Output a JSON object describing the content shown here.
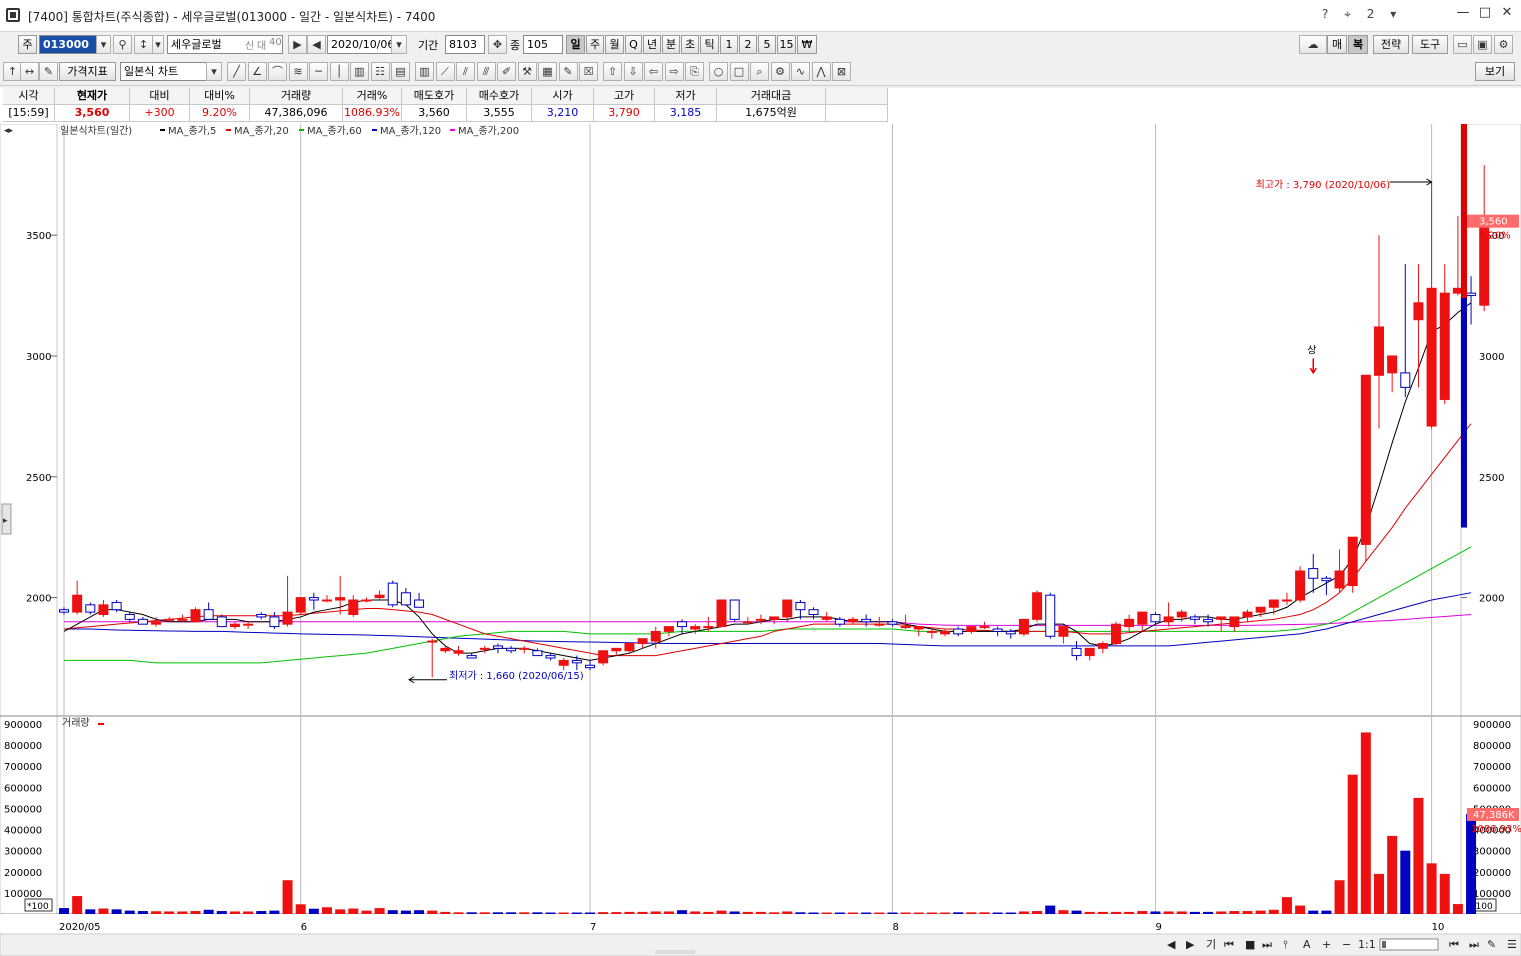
{
  "window": {
    "title": "[7400] 통합차트(주식종합) - 세우글로벌(013000 - 일간 - 일본식차트) - 7400",
    "tools": "? ⌖ 2 ▾",
    "min": "—",
    "max": "□",
    "close": "✕"
  },
  "toolbar1": {
    "type_label": "주",
    "code": "013000",
    "stock_name": "세우글로벌",
    "badges": [
      "신",
      "대",
      "40"
    ],
    "date": "2020/10/06",
    "period_label": "기간",
    "period_value": "8103",
    "count_label": "종",
    "count_value": "105",
    "timeframes": [
      "일",
      "주",
      "월",
      "Q",
      "년",
      "분",
      "초",
      "틱",
      "1",
      "2",
      "5",
      "15",
      "₩"
    ],
    "right_buttons": [
      "매",
      "복",
      "전략",
      "도구"
    ]
  },
  "toolbar2": {
    "indicator_btn": "가격지표",
    "chart_type": "일본식 차트",
    "view_btn": "보기"
  },
  "quote": {
    "headers": [
      "시각",
      "현재가",
      "대비",
      "대비%",
      "거래량",
      "거래%",
      "매도호가",
      "매수호가",
      "시가",
      "고가",
      "저가",
      "거래대금"
    ],
    "values": [
      "[15:59]",
      "3,560",
      "+300",
      "9.20%",
      "47,386,096",
      "1086.93%",
      "3,560",
      "3,555",
      "3,210",
      "3,790",
      "3,185",
      "1,675억원"
    ]
  },
  "chart_data": {
    "type": "candlestick",
    "legend": [
      "일본식차트(일간)",
      "MA_종가,5",
      "MA_종가,20",
      "MA_종가,60",
      "MA_종가,120",
      "MA_종가,200"
    ],
    "ma_colors": [
      "#000000",
      "#e00000",
      "#00c000",
      "#0000c0",
      "#e000e0"
    ],
    "up_color": "#ee1111",
    "down_color": "#0000c0",
    "ylim": [
      1510,
      3960
    ],
    "y_ticks": [
      2000,
      2500,
      3000,
      3500
    ],
    "volume_label": "거래량",
    "volume_unit": "*100",
    "volume_ylim": [
      0,
      900000
    ],
    "volume_ticks": [
      100000,
      200000,
      300000,
      400000,
      500000,
      600000,
      700000,
      800000,
      900000
    ],
    "x_labels": [
      {
        "index": 0,
        "label": "2020/05"
      },
      {
        "index": 18,
        "label": "6"
      },
      {
        "index": 40,
        "label": "7"
      },
      {
        "index": 63,
        "label": "8"
      },
      {
        "index": 83,
        "label": "9"
      },
      {
        "index": 104,
        "label": "10"
      }
    ],
    "high_annotation": "최고가 : 3,790 (2020/10/06)",
    "low_annotation": "최저가 : 1,660 (2020/06/15)",
    "limit_up_label": "상",
    "limit_up_index": 95,
    "high_index": 104,
    "low_index": 27,
    "current_price": "3,560",
    "current_pct": "9.20%",
    "current_volume": "47,386K",
    "current_volume_pct": "1086.93%",
    "ohlc": [
      [
        1950,
        1960,
        1930,
        1940
      ],
      [
        1940,
        2070,
        1930,
        2010
      ],
      [
        1970,
        1980,
        1930,
        1940
      ],
      [
        1930,
        1990,
        1920,
        1970
      ],
      [
        1980,
        1990,
        1940,
        1950
      ],
      [
        1930,
        1940,
        1900,
        1910
      ],
      [
        1910,
        1920,
        1890,
        1890
      ],
      [
        1890,
        1920,
        1880,
        1900
      ],
      [
        1910,
        1920,
        1900,
        1910
      ],
      [
        1910,
        1930,
        1900,
        1910
      ],
      [
        1900,
        1960,
        1900,
        1950
      ],
      [
        1950,
        1980,
        1910,
        1910
      ],
      [
        1920,
        1930,
        1890,
        1880
      ],
      [
        1880,
        1900,
        1870,
        1890
      ],
      [
        1890,
        1900,
        1870,
        1890
      ],
      [
        1930,
        1940,
        1910,
        1920
      ],
      [
        1920,
        1940,
        1870,
        1880
      ],
      [
        1890,
        2090,
        1880,
        1940
      ],
      [
        1940,
        2000,
        1930,
        2000
      ],
      [
        2000,
        2020,
        1950,
        1990
      ],
      [
        1990,
        2010,
        1980,
        1990
      ],
      [
        1990,
        2090,
        1930,
        2000
      ],
      [
        1930,
        2010,
        1920,
        1990
      ],
      [
        1990,
        2000,
        1980,
        1990
      ],
      [
        2000,
        2030,
        1990,
        2010
      ],
      [
        2060,
        2070,
        1960,
        1970
      ],
      [
        2020,
        2040,
        1970,
        1970
      ],
      [
        1990,
        2020,
        1970,
        1960
      ],
      [
        1820,
        1830,
        1670,
        1820
      ],
      [
        1780,
        1800,
        1770,
        1790
      ],
      [
        1770,
        1800,
        1760,
        1780
      ],
      [
        1760,
        1770,
        1750,
        1750
      ],
      [
        1790,
        1800,
        1770,
        1790
      ],
      [
        1800,
        1810,
        1770,
        1790
      ],
      [
        1790,
        1800,
        1770,
        1780
      ],
      [
        1790,
        1800,
        1770,
        1790
      ],
      [
        1780,
        1790,
        1760,
        1760
      ],
      [
        1760,
        1770,
        1740,
        1750
      ],
      [
        1720,
        1750,
        1700,
        1740
      ],
      [
        1740,
        1760,
        1700,
        1730
      ],
      [
        1720,
        1740,
        1700,
        1710
      ],
      [
        1730,
        1780,
        1720,
        1780
      ],
      [
        1780,
        1790,
        1760,
        1790
      ],
      [
        1780,
        1800,
        1770,
        1810
      ],
      [
        1810,
        1830,
        1790,
        1830
      ],
      [
        1820,
        1880,
        1790,
        1860
      ],
      [
        1860,
        1880,
        1840,
        1880
      ],
      [
        1900,
        1910,
        1850,
        1880
      ],
      [
        1870,
        1890,
        1850,
        1880
      ],
      [
        1880,
        1920,
        1860,
        1880
      ],
      [
        1880,
        1990,
        1880,
        1990
      ],
      [
        1990,
        1990,
        1900,
        1910
      ],
      [
        1900,
        1920,
        1890,
        1900
      ],
      [
        1910,
        1930,
        1890,
        1910
      ],
      [
        1910,
        1920,
        1890,
        1920
      ],
      [
        1920,
        1990,
        1900,
        1990
      ],
      [
        1980,
        1990,
        1910,
        1950
      ],
      [
        1950,
        1960,
        1910,
        1930
      ],
      [
        1910,
        1940,
        1900,
        1920
      ],
      [
        1910,
        1920,
        1880,
        1890
      ],
      [
        1900,
        1920,
        1890,
        1910
      ],
      [
        1910,
        1930,
        1880,
        1900
      ],
      [
        1890,
        1920,
        1880,
        1890
      ],
      [
        1900,
        1910,
        1880,
        1890
      ],
      [
        1880,
        1930,
        1870,
        1880
      ],
      [
        1870,
        1880,
        1840,
        1880
      ],
      [
        1860,
        1870,
        1830,
        1860
      ],
      [
        1850,
        1870,
        1840,
        1860
      ],
      [
        1870,
        1880,
        1840,
        1850
      ],
      [
        1860,
        1880,
        1850,
        1880
      ],
      [
        1880,
        1900,
        1870,
        1880
      ],
      [
        1870,
        1880,
        1840,
        1860
      ],
      [
        1860,
        1870,
        1830,
        1850
      ],
      [
        1850,
        1910,
        1840,
        1910
      ],
      [
        1910,
        2030,
        1900,
        2020
      ],
      [
        2010,
        2020,
        1830,
        1840
      ],
      [
        1840,
        1880,
        1810,
        1880
      ],
      [
        1790,
        1820,
        1740,
        1760
      ],
      [
        1760,
        1790,
        1740,
        1790
      ],
      [
        1790,
        1820,
        1770,
        1810
      ],
      [
        1810,
        1900,
        1800,
        1890
      ],
      [
        1880,
        1930,
        1860,
        1910
      ],
      [
        1890,
        1940,
        1860,
        1940
      ],
      [
        1930,
        1940,
        1890,
        1900
      ],
      [
        1900,
        1980,
        1880,
        1920
      ],
      [
        1920,
        1950,
        1900,
        1940
      ],
      [
        1920,
        1930,
        1890,
        1910
      ],
      [
        1910,
        1930,
        1880,
        1900
      ],
      [
        1910,
        1920,
        1860,
        1920
      ],
      [
        1880,
        1920,
        1860,
        1920
      ],
      [
        1920,
        1950,
        1900,
        1940
      ],
      [
        1940,
        1960,
        1920,
        1960
      ],
      [
        1960,
        1980,
        1930,
        1990
      ],
      [
        1990,
        2020,
        1970,
        1990
      ],
      [
        1990,
        2130,
        1980,
        2110
      ],
      [
        2120,
        2180,
        2020,
        2080
      ],
      [
        2080,
        2090,
        2010,
        2070
      ],
      [
        2040,
        2200,
        2020,
        2110
      ],
      [
        2050,
        2180,
        2020,
        2250
      ],
      [
        2220,
        2920,
        2150,
        2920
      ],
      [
        2920,
        3500,
        2700,
        3120
      ],
      [
        2930,
        3000,
        2850,
        3000
      ],
      [
        2930,
        3380,
        2830,
        2870
      ],
      [
        3150,
        3380,
        2870,
        3220
      ],
      [
        2710,
        3720,
        2700,
        3280
      ],
      [
        2820,
        3380,
        2800,
        3260
      ],
      [
        3260,
        3580,
        3250,
        3280
      ],
      [
        3260,
        3330,
        3130,
        3250
      ],
      [
        3210,
        3790,
        3185,
        3560
      ]
    ],
    "volume": [
      28000,
      85000,
      22000,
      26000,
      22000,
      16000,
      14000,
      13000,
      12000,
      12000,
      14000,
      20000,
      14000,
      12000,
      12000,
      14000,
      16000,
      160000,
      46000,
      25000,
      32000,
      22000,
      26000,
      16000,
      28000,
      18000,
      16000,
      18000,
      16000,
      10000,
      8000,
      8000,
      8000,
      8000,
      8000,
      8000,
      8000,
      7000,
      7000,
      7000,
      7000,
      9000,
      9000,
      10000,
      10000,
      12000,
      12000,
      18000,
      12000,
      10000,
      16000,
      12000,
      10000,
      10000,
      8000,
      12000,
      8000,
      7000,
      7000,
      7000,
      7000,
      7000,
      7000,
      7000,
      7000,
      7000,
      7000,
      7000,
      8000,
      8000,
      8000,
      7000,
      7000,
      12000,
      14000,
      40000,
      18000,
      16000,
      10000,
      10000,
      10000,
      10000,
      14000,
      12000,
      12000,
      12000,
      10000,
      10000,
      12000,
      14000,
      14000,
      16000,
      20000,
      80000,
      40000,
      16000,
      16000,
      160000,
      660000,
      860000,
      190000,
      370000,
      300000,
      550000,
      240000,
      190000,
      47000,
      473860
    ],
    "ma5": [
      1860,
      1890,
      1920,
      1950,
      1950,
      1940,
      1930,
      1910,
      1900,
      1900,
      1900,
      1910,
      1910,
      1910,
      1900,
      1900,
      1900,
      1910,
      1920,
      1940,
      1950,
      1960,
      1980,
      1990,
      1990,
      1990,
      1970,
      1920,
      1850,
      1800,
      1770,
      1770,
      1780,
      1790,
      1790,
      1790,
      1780,
      1770,
      1760,
      1750,
      1740,
      1750,
      1760,
      1770,
      1790,
      1810,
      1830,
      1850,
      1860,
      1870,
      1880,
      1890,
      1890,
      1900,
      1910,
      1910,
      1920,
      1920,
      1920,
      1910,
      1900,
      1900,
      1900,
      1900,
      1890,
      1880,
      1870,
      1860,
      1860,
      1860,
      1860,
      1860,
      1860,
      1870,
      1890,
      1890,
      1890,
      1860,
      1810,
      1800,
      1810,
      1830,
      1860,
      1890,
      1910,
      1910,
      1920,
      1920,
      1910,
      1910,
      1920,
      1930,
      1940,
      1960,
      2000,
      2030,
      2060,
      2090,
      2160,
      2290,
      2460,
      2640,
      2810,
      2950,
      3100,
      3130,
      3180,
      3220
    ],
    "ma20": [
      1870,
      1875,
      1880,
      1885,
      1890,
      1895,
      1900,
      1905,
      1910,
      1915,
      1920,
      1925,
      1925,
      1925,
      1925,
      1925,
      1925,
      1925,
      1930,
      1935,
      1940,
      1945,
      1950,
      1955,
      1955,
      1950,
      1945,
      1940,
      1930,
      1910,
      1890,
      1870,
      1850,
      1840,
      1830,
      1820,
      1810,
      1800,
      1790,
      1780,
      1770,
      1760,
      1760,
      1760,
      1760,
      1760,
      1770,
      1780,
      1790,
      1800,
      1810,
      1820,
      1830,
      1840,
      1860,
      1870,
      1880,
      1890,
      1890,
      1890,
      1890,
      1890,
      1890,
      1890,
      1885,
      1880,
      1875,
      1870,
      1870,
      1865,
      1865,
      1860,
      1860,
      1860,
      1860,
      1860,
      1860,
      1855,
      1850,
      1850,
      1850,
      1855,
      1860,
      1865,
      1870,
      1875,
      1880,
      1885,
      1890,
      1895,
      1900,
      1905,
      1910,
      1920,
      1930,
      1950,
      1980,
      2020,
      2080,
      2150,
      2220,
      2290,
      2370,
      2440,
      2510,
      2580,
      2650,
      2720
    ],
    "ma60": [
      1740,
      1740,
      1740,
      1740,
      1740,
      1740,
      1735,
      1730,
      1730,
      1730,
      1730,
      1730,
      1730,
      1730,
      1730,
      1730,
      1735,
      1740,
      1745,
      1750,
      1755,
      1760,
      1765,
      1770,
      1780,
      1790,
      1800,
      1810,
      1820,
      1830,
      1840,
      1845,
      1850,
      1855,
      1860,
      1860,
      1860,
      1860,
      1860,
      1855,
      1850,
      1850,
      1850,
      1850,
      1850,
      1850,
      1855,
      1860,
      1860,
      1860,
      1860,
      1860,
      1860,
      1860,
      1865,
      1870,
      1870,
      1870,
      1870,
      1870,
      1870,
      1870,
      1870,
      1870,
      1865,
      1860,
      1860,
      1860,
      1860,
      1860,
      1860,
      1860,
      1860,
      1860,
      1860,
      1860,
      1860,
      1860,
      1860,
      1860,
      1860,
      1860,
      1860,
      1860,
      1860,
      1860,
      1860,
      1860,
      1860,
      1860,
      1860,
      1860,
      1860,
      1865,
      1870,
      1880,
      1890,
      1910,
      1940,
      1970,
      2000,
      2030,
      2060,
      2090,
      2120,
      2150,
      2180,
      2210
    ],
    "ma120": [
      1870,
      1870,
      1870,
      1868,
      1866,
      1865,
      1864,
      1863,
      1862,
      1861,
      1860,
      1860,
      1860,
      1858,
      1856,
      1855,
      1853,
      1852,
      1850,
      1849,
      1848,
      1847,
      1846,
      1845,
      1843,
      1842,
      1840,
      1838,
      1836,
      1834,
      1832,
      1830,
      1828,
      1826,
      1824,
      1822,
      1820,
      1819,
      1818,
      1817,
      1816,
      1815,
      1814,
      1813,
      1812,
      1811,
      1810,
      1810,
      1810,
      1810,
      1810,
      1810,
      1810,
      1810,
      1810,
      1810,
      1810,
      1810,
      1810,
      1810,
      1810,
      1810,
      1810,
      1808,
      1806,
      1804,
      1802,
      1800,
      1800,
      1800,
      1800,
      1800,
      1800,
      1800,
      1800,
      1800,
      1800,
      1800,
      1800,
      1800,
      1800,
      1800,
      1800,
      1800,
      1800,
      1805,
      1810,
      1815,
      1820,
      1825,
      1830,
      1835,
      1840,
      1845,
      1850,
      1860,
      1870,
      1885,
      1900,
      1915,
      1930,
      1945,
      1960,
      1975,
      1990,
      2000,
      2010,
      2020
    ],
    "ma200": [
      1900,
      1900,
      1900,
      1900,
      1900,
      1900,
      1900,
      1900,
      1900,
      1900,
      1900,
      1900,
      1900,
      1900,
      1900,
      1900,
      1900,
      1900,
      1900,
      1900,
      1900,
      1900,
      1900,
      1900,
      1900,
      1900,
      1900,
      1900,
      1900,
      1900,
      1900,
      1900,
      1900,
      1900,
      1900,
      1900,
      1900,
      1900,
      1900,
      1900,
      1900,
      1900,
      1900,
      1900,
      1900,
      1900,
      1900,
      1900,
      1900,
      1900,
      1900,
      1900,
      1900,
      1900,
      1900,
      1900,
      1900,
      1900,
      1900,
      1900,
      1900,
      1900,
      1900,
      1900,
      1895,
      1890,
      1888,
      1886,
      1885,
      1885,
      1885,
      1885,
      1885,
      1885,
      1885,
      1885,
      1885,
      1885,
      1885,
      1885,
      1885,
      1885,
      1885,
      1885,
      1885,
      1885,
      1885,
      1885,
      1885,
      1885,
      1885,
      1886,
      1887,
      1888,
      1889,
      1890,
      1892,
      1895,
      1898,
      1900,
      1903,
      1906,
      1910,
      1914,
      1918,
      1922,
      1926,
      1930
    ]
  },
  "bottom_toolbar": {
    "buttons": [
      "◀",
      "▶",
      "기",
      "⏮",
      "■",
      "⏭",
      "⫯",
      "A",
      "+",
      "−",
      "1:1",
      "⏮",
      "⏭",
      "✎",
      "☰"
    ]
  }
}
